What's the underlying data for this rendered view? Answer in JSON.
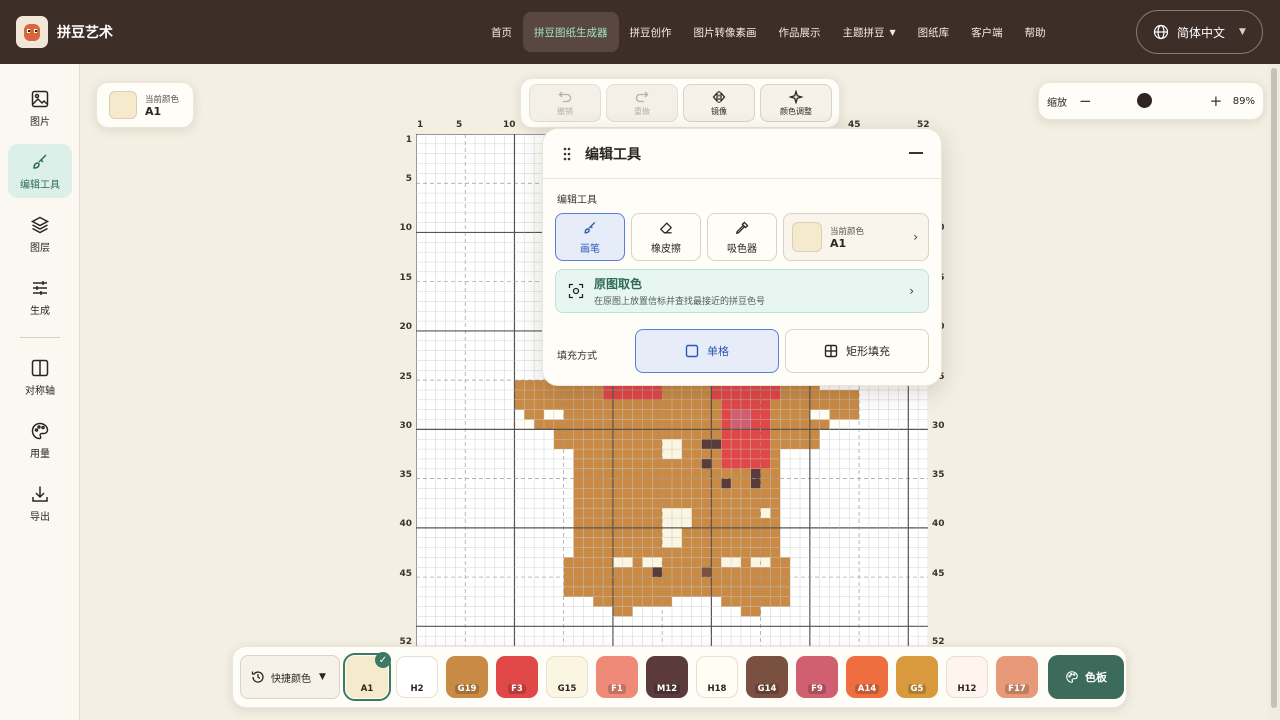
{
  "app": {
    "name": "拼豆艺术"
  },
  "nav": {
    "items": [
      "首页",
      "拼豆图纸生成器",
      "拼豆创作",
      "图片转像素画",
      "作品展示",
      "主题拼豆",
      "图纸库",
      "客户端",
      "帮助"
    ],
    "active_index": 1,
    "dropdown_index": 5
  },
  "language": {
    "label": "简体中文"
  },
  "rail": {
    "items": [
      {
        "label": "图片",
        "icon": "image-icon"
      },
      {
        "label": "编辑工具",
        "icon": "brush-icon",
        "active": true
      },
      {
        "label": "图层",
        "icon": "layers-icon"
      },
      {
        "label": "生成",
        "icon": "sliders-icon"
      },
      {
        "label": "对称轴",
        "icon": "symmetry-icon"
      },
      {
        "label": "用量",
        "icon": "palette-icon"
      },
      {
        "label": "导出",
        "icon": "download-icon"
      }
    ]
  },
  "current_color": {
    "caption": "当前颜色",
    "code": "A1",
    "hex": "#f5ebcc"
  },
  "toolbar": {
    "undo": "撤销",
    "redo": "重做",
    "mirror": "镜像",
    "adjust": "颜色调整"
  },
  "zoom": {
    "label": "缩放",
    "value": "89%",
    "level": 0.42
  },
  "grid": {
    "cols": 52,
    "rows": 52,
    "top_ticks": [
      "1",
      "5",
      "10",
      "45",
      "52"
    ],
    "side_ticks": [
      "1",
      "5",
      "10",
      "15",
      "20",
      "25",
      "30",
      "35",
      "40",
      "45",
      "52"
    ],
    "right_ticks": [
      "10",
      "15",
      "20",
      "25",
      "30",
      "35",
      "40",
      "45",
      "52"
    ]
  },
  "edit_panel": {
    "title": "编辑工具",
    "section_label": "编辑工具",
    "tools": [
      "画笔",
      "橡皮擦",
      "吸色器"
    ],
    "active_tool": 0,
    "color_caption": "当前颜色",
    "color_code": "A1",
    "pick_title": "原图取色",
    "pick_desc": "在原图上放置信标并查找最接近的拼豆色号",
    "fill_label": "填充方式",
    "fill_modes": [
      "单格",
      "矩形填充"
    ],
    "active_fill": 0
  },
  "palette": {
    "quick_label": "快捷颜色",
    "button_label": "色板",
    "colors": [
      {
        "code": "A1",
        "hex": "#f5ebcc",
        "selected": true
      },
      {
        "code": "H2",
        "hex": "#ffffff"
      },
      {
        "code": "G19",
        "hex": "#c98a45"
      },
      {
        "code": "F3",
        "hex": "#e04848"
      },
      {
        "code": "G15",
        "hex": "#fbf6e2"
      },
      {
        "code": "F1",
        "hex": "#ef8a78"
      },
      {
        "code": "M12",
        "hex": "#5a3a3a"
      },
      {
        "code": "H18",
        "hex": "#fffdf4"
      },
      {
        "code": "G14",
        "hex": "#7a5040"
      },
      {
        "code": "F9",
        "hex": "#d06070"
      },
      {
        "code": "A14",
        "hex": "#ee6e40"
      },
      {
        "code": "G5",
        "hex": "#d89a3c"
      },
      {
        "code": "H12",
        "hex": "#fff5ee"
      },
      {
        "code": "F17",
        "hex": "#e89a78"
      }
    ]
  }
}
